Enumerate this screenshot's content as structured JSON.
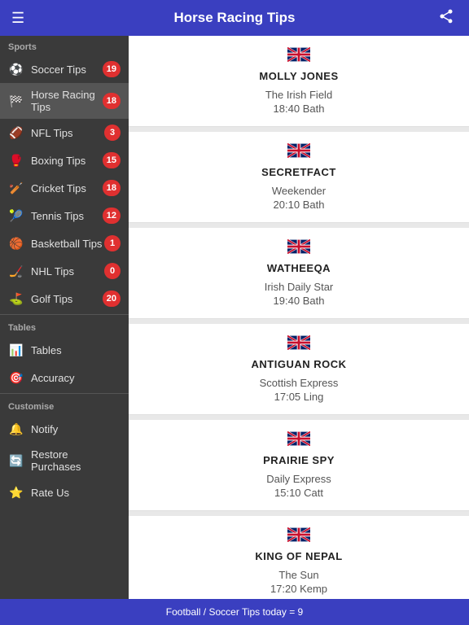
{
  "header": {
    "title": "Horse Racing Tips",
    "menu_icon": "☰",
    "share_icon": "share"
  },
  "sidebar": {
    "sports_label": "Sports",
    "items": [
      {
        "id": "soccer",
        "label": "Soccer Tips",
        "icon": "⚽",
        "badge": "19",
        "active": false
      },
      {
        "id": "horse-racing",
        "label": "Horse Racing Tips",
        "icon": "🏁",
        "badge": "18",
        "active": true
      },
      {
        "id": "nfl",
        "label": "NFL Tips",
        "icon": "🏈",
        "badge": "3",
        "active": false
      },
      {
        "id": "boxing",
        "label": "Boxing Tips",
        "icon": "🥊",
        "badge": "15",
        "active": false
      },
      {
        "id": "cricket",
        "label": "Cricket Tips",
        "icon": "🏏",
        "badge": "18",
        "active": false
      },
      {
        "id": "tennis",
        "label": "Tennis Tips",
        "icon": "🎾",
        "badge": "12",
        "active": false
      },
      {
        "id": "basketball",
        "label": "Basketball Tips",
        "icon": "🏀",
        "badge": "1",
        "active": false
      },
      {
        "id": "nhl",
        "label": "NHL Tips",
        "icon": "🏒",
        "badge": "0",
        "active": false
      },
      {
        "id": "golf",
        "label": "Golf Tips",
        "icon": "⛳",
        "badge": "20",
        "active": false
      }
    ],
    "tables_label": "Tables",
    "tables_items": [
      {
        "id": "tables",
        "label": "Tables",
        "icon": "📊"
      },
      {
        "id": "accuracy",
        "label": "Accuracy",
        "icon": "🎯"
      }
    ],
    "customise_label": "Customise",
    "customise_items": [
      {
        "id": "notify",
        "label": "Notify",
        "icon": "🔔"
      },
      {
        "id": "restore",
        "label": "Restore Purchases",
        "icon": "🔄"
      },
      {
        "id": "rate",
        "label": "Rate Us",
        "icon": "⭐"
      }
    ]
  },
  "tips": [
    {
      "name": "MOLLY JONES",
      "source": "The Irish Field",
      "time": "18:40 Bath"
    },
    {
      "name": "SECRETFACT",
      "source": "Weekender",
      "time": "20:10 Bath"
    },
    {
      "name": "WATHEEQA",
      "source": "Irish Daily Star",
      "time": "19:40 Bath"
    },
    {
      "name": "ANTIGUAN ROCK",
      "source": "Scottish Express",
      "time": "17:05 Ling"
    },
    {
      "name": "PRAIRIE SPY",
      "source": "Daily Express",
      "time": "15:10 Catt"
    },
    {
      "name": "KING OF NEPAL",
      "source": "The Sun",
      "time": "17:20 Kemp"
    }
  ],
  "footer": {
    "text": "Football / Soccer Tips today = 9"
  }
}
